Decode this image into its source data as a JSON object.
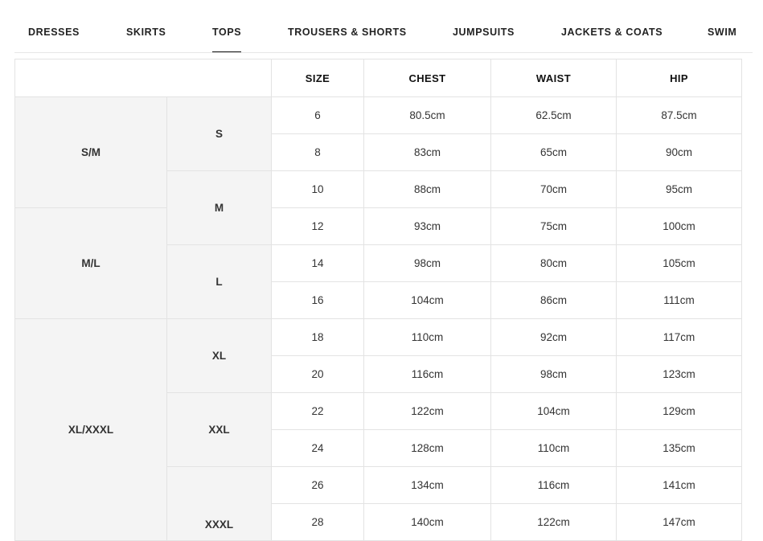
{
  "tabs": [
    {
      "label": "DRESSES",
      "active": false
    },
    {
      "label": "SKIRTS",
      "active": false
    },
    {
      "label": "TOPS",
      "active": true
    },
    {
      "label": "TROUSERS & SHORTS",
      "active": false
    },
    {
      "label": "JUMPSUITS",
      "active": false
    },
    {
      "label": "JACKETS & COATS",
      "active": false
    },
    {
      "label": "SWIM",
      "active": false
    }
  ],
  "table": {
    "headers": [
      "SIZE",
      "CHEST",
      "WAIST",
      "HIP"
    ],
    "groups": [
      "S/M",
      "M/L",
      "XL/XXXL"
    ],
    "subs": [
      "S",
      "M",
      "L",
      "XL",
      "XXL",
      "XXXL"
    ],
    "rows": [
      {
        "size": "6",
        "chest": "80.5cm",
        "waist": "62.5cm",
        "hip": "87.5cm"
      },
      {
        "size": "8",
        "chest": "83cm",
        "waist": "65cm",
        "hip": "90cm"
      },
      {
        "size": "10",
        "chest": "88cm",
        "waist": "70cm",
        "hip": "95cm"
      },
      {
        "size": "12",
        "chest": "93cm",
        "waist": "75cm",
        "hip": "100cm"
      },
      {
        "size": "14",
        "chest": "98cm",
        "waist": "80cm",
        "hip": "105cm"
      },
      {
        "size": "16",
        "chest": "104cm",
        "waist": "86cm",
        "hip": "111cm"
      },
      {
        "size": "18",
        "chest": "110cm",
        "waist": "92cm",
        "hip": "117cm"
      },
      {
        "size": "20",
        "chest": "116cm",
        "waist": "98cm",
        "hip": "123cm"
      },
      {
        "size": "22",
        "chest": "122cm",
        "waist": "104cm",
        "hip": "129cm"
      },
      {
        "size": "24",
        "chest": "128cm",
        "waist": "110cm",
        "hip": "135cm"
      },
      {
        "size": "26",
        "chest": "134cm",
        "waist": "116cm",
        "hip": "141cm"
      },
      {
        "size": "28",
        "chest": "140cm",
        "waist": "122cm",
        "hip": "147cm"
      }
    ]
  }
}
